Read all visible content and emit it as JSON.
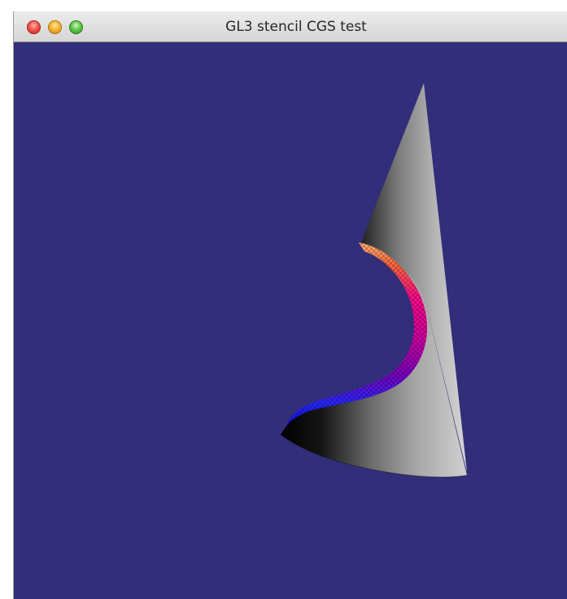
{
  "window": {
    "title": "GL3 stencil CGS test",
    "controls": {
      "close": "close-button",
      "minimize": "minimize-button",
      "zoom": "zoom-button"
    }
  },
  "viewport": {
    "background_color": "#322e79",
    "scene_description_colors": {
      "cone_light": "#c8c8c8",
      "cone_dark": "#000000",
      "cut_hot": "#ff007f",
      "cut_mid": "#b000c8",
      "cut_cool": "#2020ff",
      "cut_highlight": "#ff8f4f"
    }
  }
}
